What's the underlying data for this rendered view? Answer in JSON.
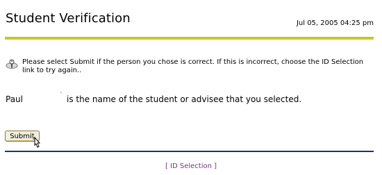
{
  "header": {
    "title": "Student Verification",
    "timestamp": "Jul 05, 2005 04:25 pm"
  },
  "info": {
    "icon": "info-icon",
    "message": "Please select Submit if the person you chose is correct. If this is incorrect, choose the ID Selection link to try again.."
  },
  "student": {
    "name": "Paul",
    "mark": "`",
    "sentence": "is the name of the student or advisee that you selected."
  },
  "form": {
    "submit_label": "Submit"
  },
  "footer": {
    "open_bracket": "[",
    "link_label": "ID Selection",
    "close_bracket": "]"
  },
  "colors": {
    "top_rule": "#c8c826",
    "bottom_rule": "#1d3466",
    "link": "#7a2f8e"
  }
}
